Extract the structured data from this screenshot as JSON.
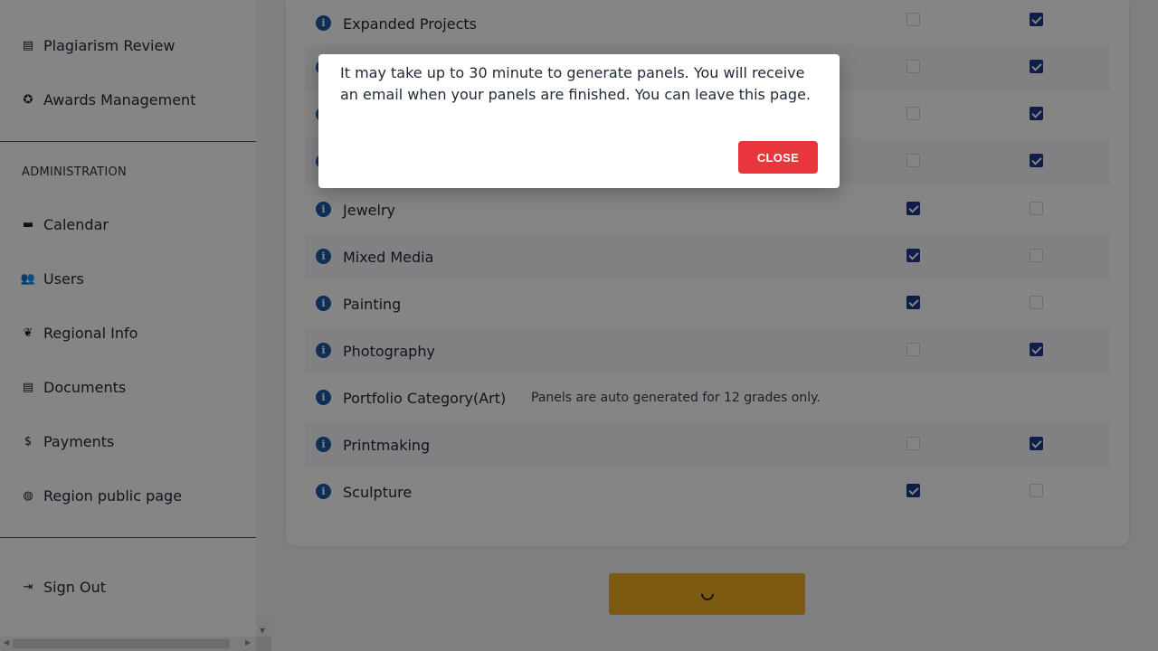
{
  "sidebar": {
    "items_top": [
      {
        "label": "Plagiarism Review",
        "icon": "document-search-icon",
        "glyph": "▤"
      },
      {
        "label": "Awards Management",
        "icon": "award-icon",
        "glyph": "✪"
      }
    ],
    "section_title": "ADMINISTRATION",
    "items_admin": [
      {
        "label": "Calendar",
        "icon": "calendar-icon",
        "glyph": "▬"
      },
      {
        "label": "Users",
        "icon": "users-icon",
        "glyph": "👥"
      },
      {
        "label": "Regional Info",
        "icon": "dove-icon",
        "glyph": "❦"
      },
      {
        "label": "Documents",
        "icon": "file-icon",
        "glyph": "▤"
      },
      {
        "label": "Payments",
        "icon": "dollar-icon",
        "glyph": "$"
      },
      {
        "label": "Region public page",
        "icon": "globe-icon",
        "glyph": "◍"
      }
    ],
    "sign_out": {
      "label": "Sign Out",
      "icon": "sign-out-icon",
      "glyph": "⇥"
    }
  },
  "categories": [
    {
      "label": "Expanded Projects",
      "col1": false,
      "col2": true
    },
    {
      "label": "",
      "col1": false,
      "col2": true
    },
    {
      "label": "",
      "col1": false,
      "col2": true
    },
    {
      "label": "",
      "col1": false,
      "col2": true
    },
    {
      "label": "Jewelry",
      "col1": true,
      "col2": false
    },
    {
      "label": "Mixed Media",
      "col1": true,
      "col2": false
    },
    {
      "label": "Painting",
      "col1": true,
      "col2": false
    },
    {
      "label": "Photography",
      "col1": false,
      "col2": true
    },
    {
      "label": "Portfolio Category(Art)",
      "note": "Panels are auto generated for 12 grades only."
    },
    {
      "label": "Printmaking",
      "col1": false,
      "col2": true
    },
    {
      "label": "Sculpture",
      "col1": true,
      "col2": false
    }
  ],
  "modal": {
    "message": "It may take up to 30 minute to generate panels. You will receive an email when your panels are finished. You can leave this page.",
    "close_label": "CLOSE"
  },
  "colors": {
    "accent_button": "#f0ad22",
    "close_button": "#e8363c",
    "checkbox_on": "#1e3a8a",
    "info_icon": "#1e5aa8"
  }
}
